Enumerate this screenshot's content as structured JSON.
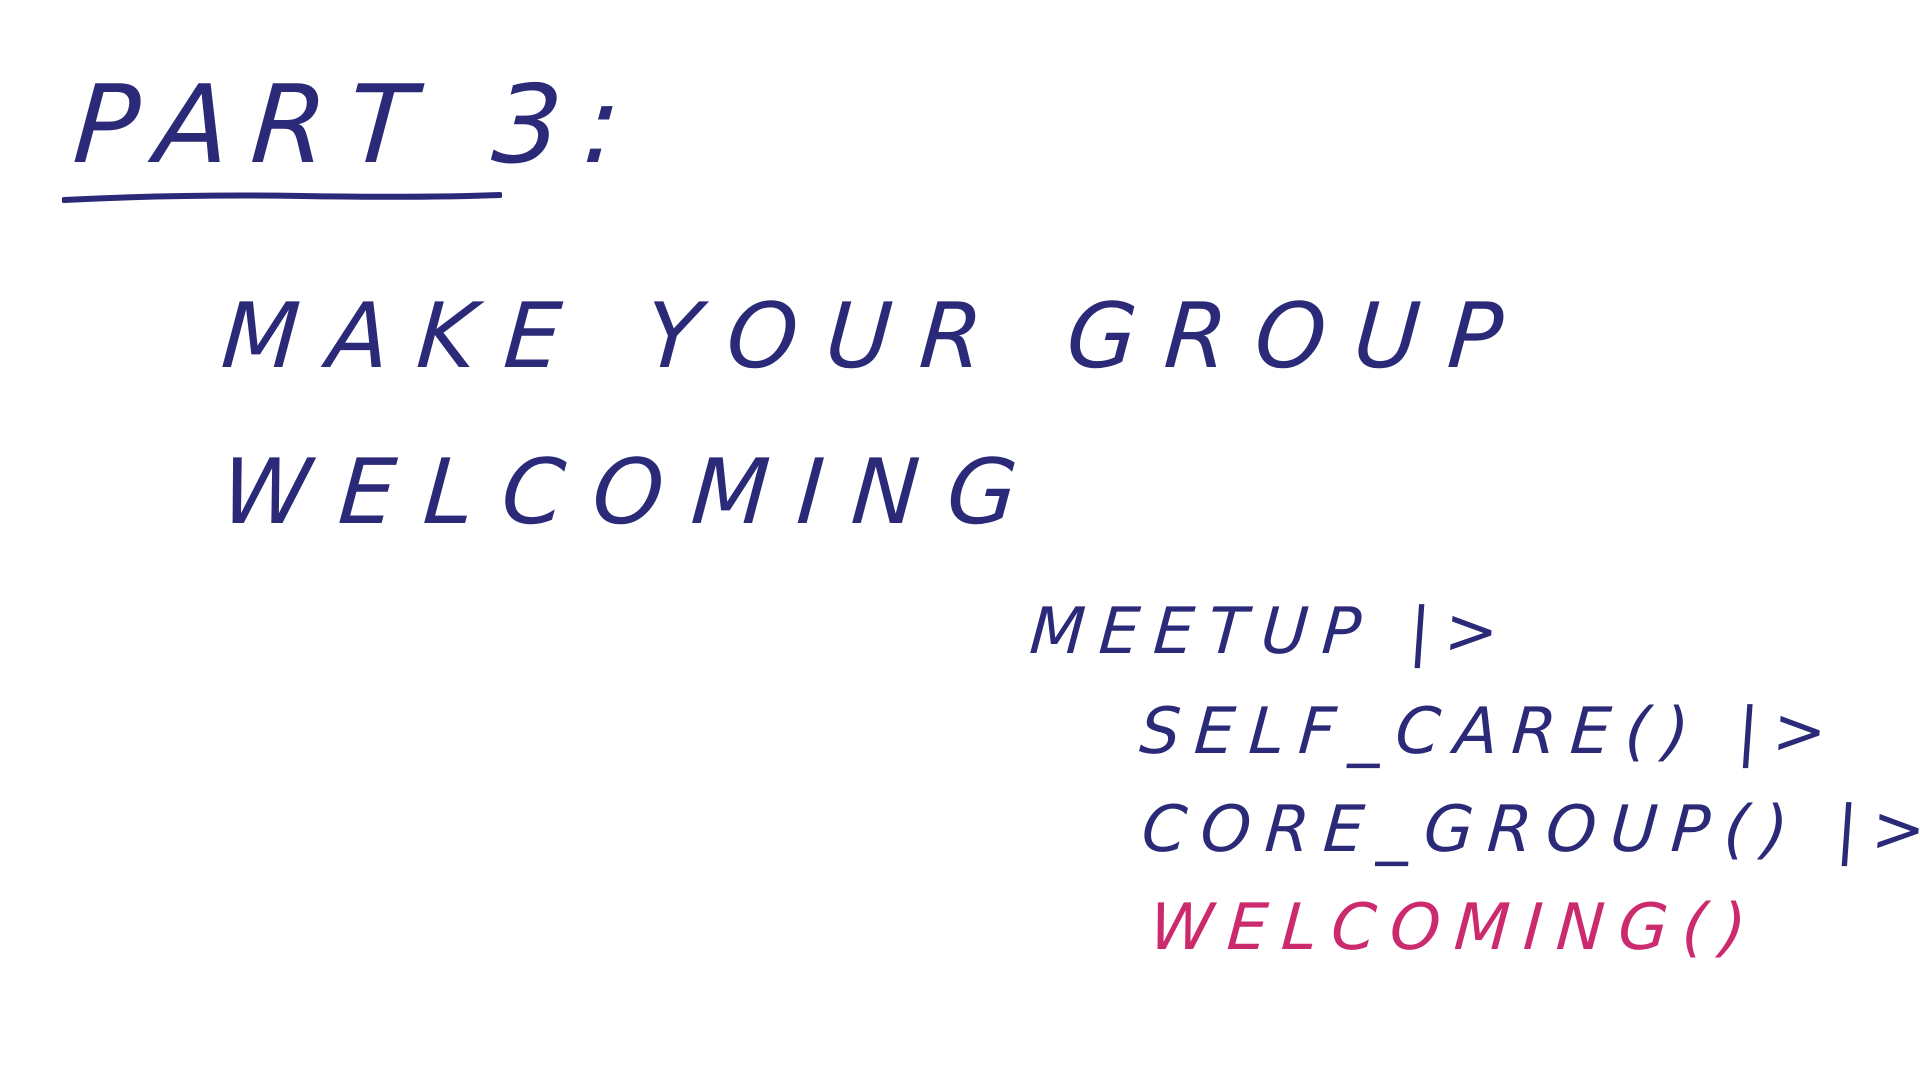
{
  "slide": {
    "part_title": "PART 3:",
    "headline_line1": "MAKE YOUR GROUP",
    "headline_line2": "WELCOMING",
    "code": {
      "line1": "MEETUP |>",
      "line2": "SELF_CARE() |>",
      "line3": "CORE_GROUP() |>",
      "line4": "WELCOMING()"
    }
  },
  "colors": {
    "ink": "#2b2a78",
    "highlight": "#cc2a6e",
    "background": "#ffffff"
  }
}
